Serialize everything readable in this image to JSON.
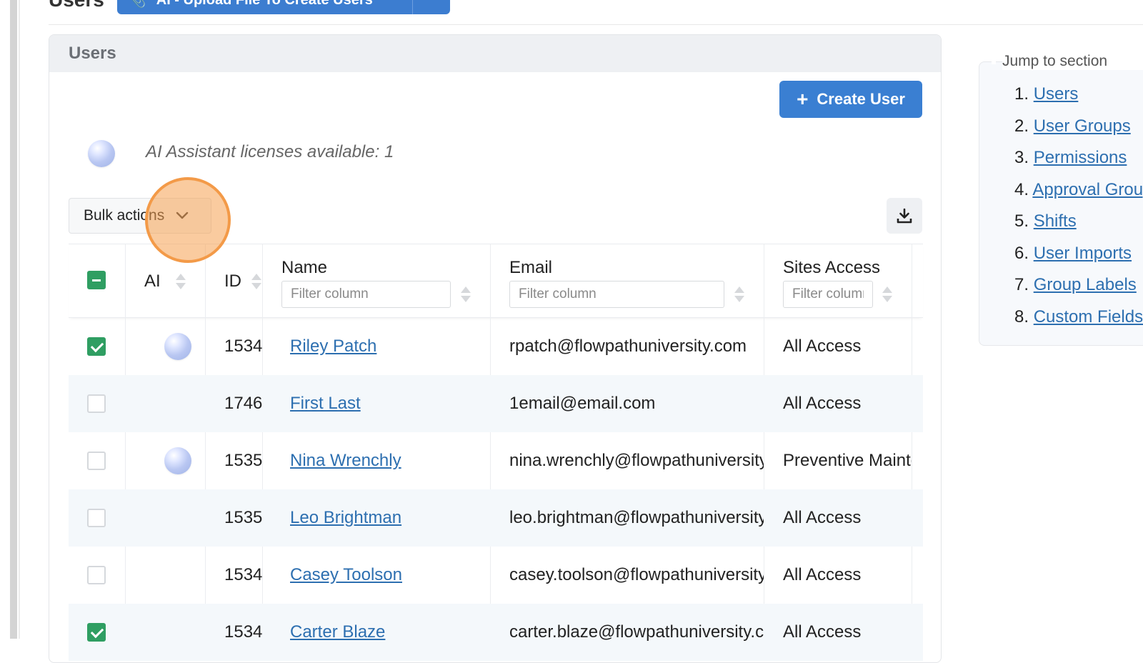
{
  "header": {
    "title": "Users",
    "ai_upload_label": "AI - Upload File To Create Users"
  },
  "card": {
    "title": "Users",
    "create_button": "Create User",
    "license_text": "AI Assistant licenses available: 1",
    "bulk_actions": "Bulk actions"
  },
  "table": {
    "columns": {
      "ai": "AI",
      "id": "ID",
      "name": "Name",
      "email": "Email",
      "sites": "Sites Access"
    },
    "filter_placeholder": "Filter column",
    "rows": [
      {
        "checked": true,
        "ai": true,
        "id": "1534",
        "name": "Riley Patch",
        "email": "rpatch@flowpathuniversity.com",
        "sites": "All Access"
      },
      {
        "checked": false,
        "ai": false,
        "id": "1746",
        "name": "First Last",
        "email": "1email@email.com",
        "sites": "All Access"
      },
      {
        "checked": false,
        "ai": true,
        "id": "1535",
        "name": "Nina Wrenchly",
        "email": "nina.wrenchly@flowpathuniversity.com",
        "sites": "Preventive Maintenance"
      },
      {
        "checked": false,
        "ai": false,
        "id": "1535",
        "name": "Leo Brightman",
        "email": "leo.brightman@flowpathuniversity.com",
        "sites": "All Access"
      },
      {
        "checked": false,
        "ai": false,
        "id": "1534",
        "name": "Casey Toolson",
        "email": "casey.toolson@flowpathuniversity.com",
        "sites": "All Access"
      },
      {
        "checked": true,
        "ai": false,
        "id": "1534",
        "name": "Carter Blaze",
        "email": "carter.blaze@flowpathuniversity.com",
        "sites": "All Access"
      }
    ]
  },
  "jump": {
    "title": "Jump to section",
    "items": [
      {
        "num": "1.",
        "label": "Users"
      },
      {
        "num": "2.",
        "label": "User Groups"
      },
      {
        "num": "3.",
        "label": "Permissions"
      },
      {
        "num": "4.",
        "label": "Approval Groups"
      },
      {
        "num": "5.",
        "label": "Shifts"
      },
      {
        "num": "6.",
        "label": "User Imports"
      },
      {
        "num": "7.",
        "label": "Group Labels"
      },
      {
        "num": "8.",
        "label": "Custom Fields"
      }
    ]
  },
  "colors": {
    "primary": "#3a7fd2",
    "link": "#2d6fb0",
    "check": "#2f9e62",
    "highlight": "#f39a48"
  }
}
